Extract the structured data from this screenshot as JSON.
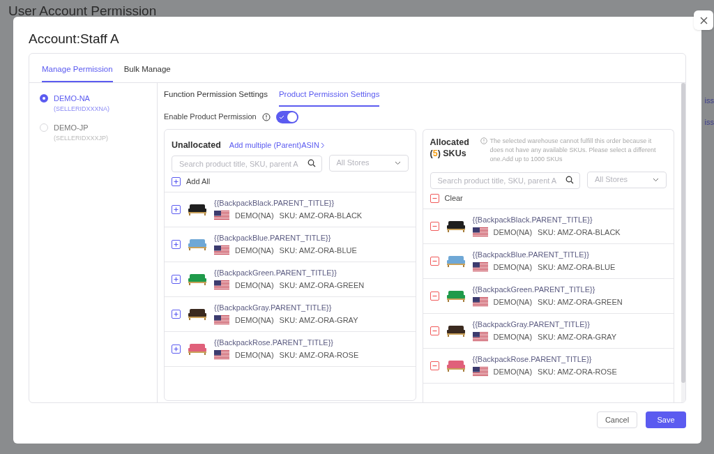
{
  "page": {
    "title": "User Account Permission",
    "links": [
      "iss",
      "iss"
    ]
  },
  "modal": {
    "title": "Account:Staff A",
    "tabs": [
      {
        "label": "Manage Permission",
        "selected": true
      },
      {
        "label": "Bulk Manage",
        "selected": false
      }
    ],
    "accounts": [
      {
        "name": "DEMO-NA",
        "id": "(SELLERIDXXXNA)",
        "selected": true
      },
      {
        "name": "DEMO-JP",
        "id": "(SELLERIDXXXJP)",
        "selected": false
      }
    ],
    "subtabs": [
      {
        "label": "Function Permission Settings",
        "selected": false
      },
      {
        "label": "Product Permission Settings",
        "selected": true
      }
    ],
    "toggle": {
      "label": "Enable Product Permission",
      "on": true
    },
    "unallocated": {
      "title": "Unallocated",
      "link": "Add multiple (Parent)ASIN",
      "search": {
        "placeholder": "Search product title, SKU, parent A"
      },
      "store": {
        "placeholder": "All Stores"
      },
      "action": "Add All",
      "items": [
        {
          "title": "{{BackpackBlack.PARENT_TITLE}}",
          "store": "DEMO(NA)",
          "sku": "SKU: AMZ-ORA-BLACK",
          "color": "#1f1f1f"
        },
        {
          "title": "{{BackpackBlue.PARENT_TITLE}}",
          "store": "DEMO(NA)",
          "sku": "SKU: AMZ-ORA-BLUE",
          "color": "#6fa8d6"
        },
        {
          "title": "{{BackpackGreen.PARENT_TITLE}}",
          "store": "DEMO(NA)",
          "sku": "SKU: AMZ-ORA-GREEN",
          "color": "#1f9a4a"
        },
        {
          "title": "{{BackpackGray.PARENT_TITLE}}",
          "store": "DEMO(NA)",
          "sku": "SKU: AMZ-ORA-GRAY",
          "color": "#3b2a1f"
        },
        {
          "title": "{{BackpackRose.PARENT_TITLE}}",
          "store": "DEMO(NA)",
          "sku": "SKU: AMZ-ORA-ROSE",
          "color": "#e0607a"
        }
      ]
    },
    "allocated": {
      "title_before": "Allocated (",
      "count": "5",
      "title_after": ") SKUs",
      "note": "The selected warehouse cannot fulfill this order because it does not have any available SKUs. Please select a different one.Add up to 1000 SKUs",
      "search": {
        "placeholder": "Search product title, SKU, parent A"
      },
      "store": {
        "placeholder": "All Stores"
      },
      "action": "Clear",
      "items": [
        {
          "title": "{{BackpackBlack.PARENT_TITLE}}",
          "store": "DEMO(NA)",
          "sku": "SKU: AMZ-ORA-BLACK",
          "color": "#1f1f1f"
        },
        {
          "title": "{{BackpackBlue.PARENT_TITLE}}",
          "store": "DEMO(NA)",
          "sku": "SKU: AMZ-ORA-BLUE",
          "color": "#6fa8d6"
        },
        {
          "title": "{{BackpackGreen.PARENT_TITLE}}",
          "store": "DEMO(NA)",
          "sku": "SKU: AMZ-ORA-GREEN",
          "color": "#1f9a4a"
        },
        {
          "title": "{{BackpackGray.PARENT_TITLE}}",
          "store": "DEMO(NA)",
          "sku": "SKU: AMZ-ORA-GRAY",
          "color": "#3b2a1f"
        },
        {
          "title": "{{BackpackRose.PARENT_TITLE}}",
          "store": "DEMO(NA)",
          "sku": "SKU: AMZ-ORA-ROSE",
          "color": "#e0607a"
        }
      ]
    },
    "buttons": [
      {
        "label": "Cancel",
        "kind": "secondary"
      },
      {
        "label": "Save",
        "kind": "primary"
      }
    ]
  }
}
